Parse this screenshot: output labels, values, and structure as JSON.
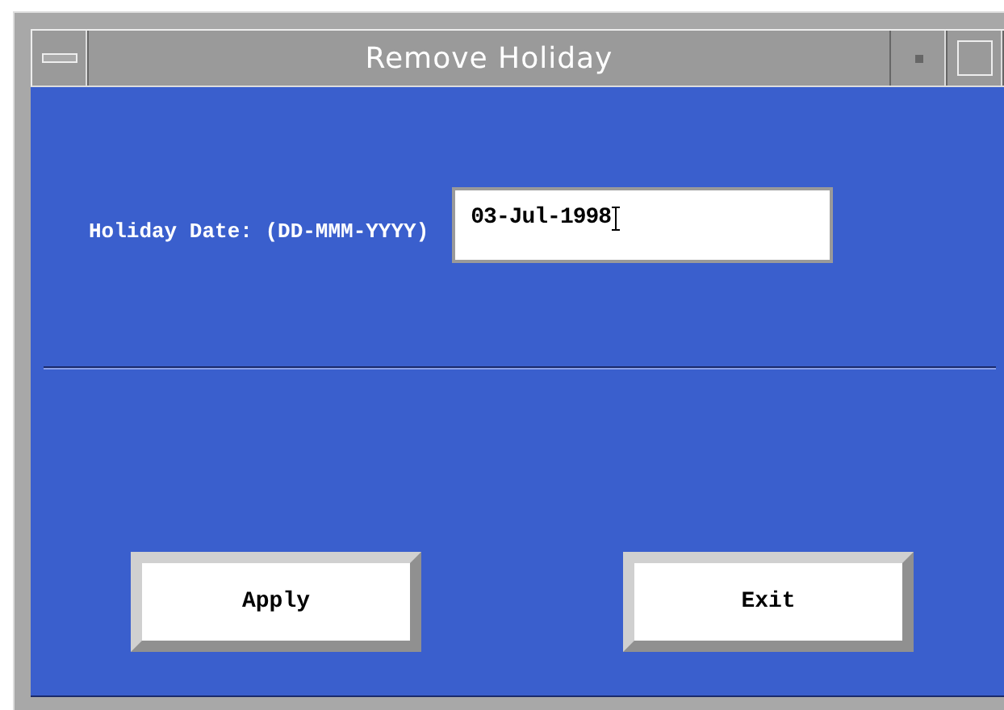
{
  "window": {
    "title": "Remove Holiday"
  },
  "date_field": {
    "label": "Holiday Date: (DD-MMM-YYYY)",
    "value": "03-Jul-1998"
  },
  "buttons": [
    {
      "label": "Apply"
    },
    {
      "label": "Exit"
    }
  ]
}
